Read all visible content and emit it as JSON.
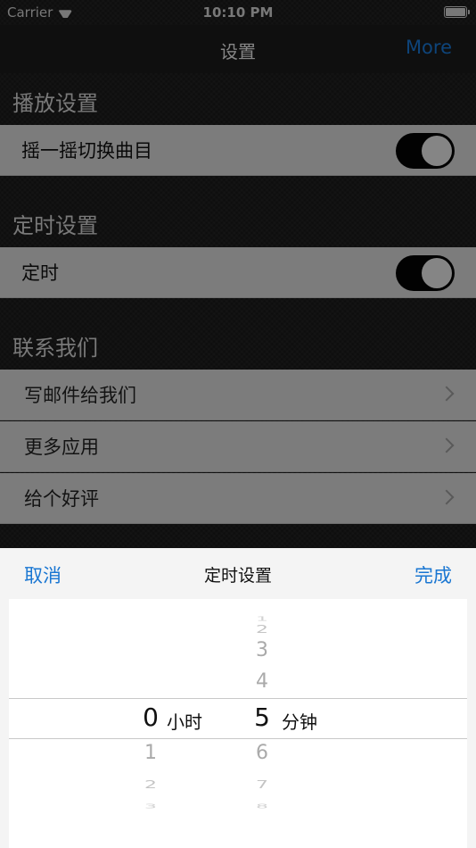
{
  "status": {
    "carrier": "Carrier",
    "time": "10:10 PM"
  },
  "nav": {
    "title": "设置",
    "more": "More"
  },
  "sections": {
    "playback": {
      "header": "播放设置",
      "shake": {
        "label": "摇一摇切换曲目",
        "on": true
      }
    },
    "timer": {
      "header": "定时设置",
      "timer": {
        "label": "定时",
        "on": true
      }
    },
    "contact": {
      "header": "联系我们",
      "items": [
        {
          "label": "写邮件给我们"
        },
        {
          "label": "更多应用"
        },
        {
          "label": "给个好评"
        }
      ]
    }
  },
  "picker": {
    "cancel": "取消",
    "title": "定时设置",
    "done": "完成",
    "hours": {
      "unit": "小时",
      "selected": "0",
      "below": [
        "1",
        "2",
        "3"
      ]
    },
    "minutes": {
      "unit": "分钟",
      "above": [
        "1",
        "2",
        "3",
        "4"
      ],
      "selected": "5",
      "below": [
        "6",
        "7",
        "8"
      ]
    }
  },
  "colors": {
    "accent": "#1976d2",
    "toggle_on": "#050505"
  },
  "icons": {
    "wifi": "wifi-icon",
    "battery": "battery-icon",
    "chevron": "chevron-right-icon"
  }
}
